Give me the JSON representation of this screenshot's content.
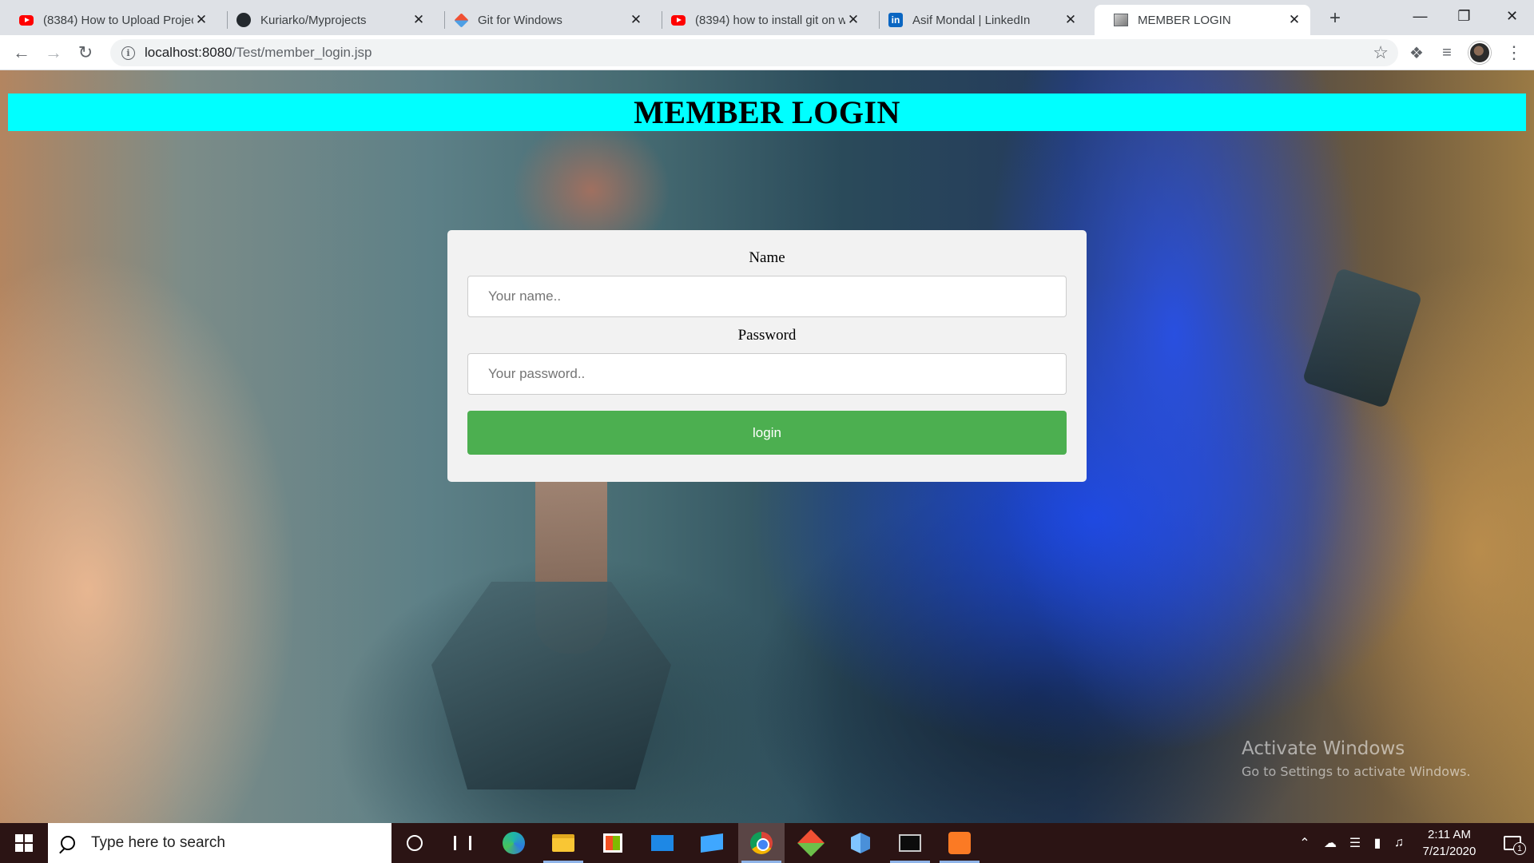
{
  "browser": {
    "tabs": [
      {
        "title": "(8384) How to Upload Project",
        "favicon": "youtube-icon"
      },
      {
        "title": "Kuriarko/Myprojects",
        "favicon": "github-icon"
      },
      {
        "title": "Git for Windows",
        "favicon": "git-icon"
      },
      {
        "title": "(8394) how to install git on w",
        "favicon": "youtube-icon"
      },
      {
        "title": "Asif Mondal | LinkedIn",
        "favicon": "linkedin-icon"
      },
      {
        "title": "MEMBER LOGIN",
        "favicon": "page-icon"
      }
    ],
    "active_tab": 5,
    "new_tab_glyph": "+",
    "url_host": "localhost:8080",
    "url_path": "/Test/member_login.jsp"
  },
  "page": {
    "header_title": "MEMBER LOGIN",
    "header_color": "#00ffff",
    "form": {
      "name_label": "Name",
      "name_placeholder": "Your name..",
      "password_label": "Password",
      "password_placeholder": "Your password..",
      "submit_label": "login",
      "submit_color": "#4caf50"
    },
    "watermark": {
      "line1": "Activate Windows",
      "line2": "Go to Settings to activate Windows."
    }
  },
  "taskbar": {
    "search_placeholder": "Type here to search",
    "apps": [
      "cortana-icon",
      "task-view-icon",
      "edge-icon",
      "file-explorer-icon",
      "store-icon",
      "mail-icon",
      "this-pc-icon",
      "chrome-icon",
      "git-gui-icon",
      "virtualbox-icon",
      "command-prompt-icon",
      "xampp-icon"
    ],
    "time": "2:11 AM",
    "date": "7/21/2020",
    "notification_count": "1"
  }
}
